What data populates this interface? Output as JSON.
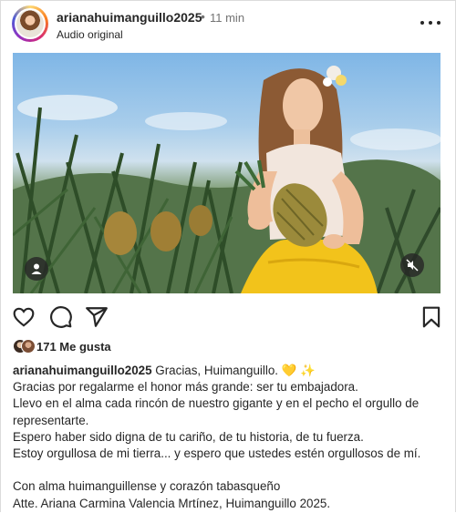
{
  "post": {
    "username": "arianahuimanguillo2025",
    "separator": "•",
    "time_ago": "11 min",
    "audio": "Audio original"
  },
  "icons": {
    "more": "more-options-icon",
    "like": "heart-icon",
    "comment": "comment-icon",
    "share": "share-icon",
    "save": "bookmark-icon",
    "tagged": "user-tag-icon",
    "mute": "muted-speaker-icon"
  },
  "likes": {
    "text": "171 Me gusta"
  },
  "caption": {
    "username": "arianahuimanguillo2025",
    "first_line": "Gracias, Huimanguillo.",
    "emoji_heart": "💛",
    "emoji_sparkle": "✨",
    "lines": [
      "Gracias por regalarme el honor más grande: ser tu embajadora.",
      "Llevo en el alma cada rincón de nuestro gigante y en el pecho el orgullo de representarte.",
      "Espero haber sido digna de tu cariño, de tu historia, de tu fuerza.",
      "Estoy orgullosa de mi tierra... y espero que ustedes estén orgullosos de mí."
    ],
    "closing": [
      "Con alma huimanguillense y corazón tabasqueño",
      "Atte. Ariana Carmina Valencia Mrtínez, Huimanguillo 2025."
    ]
  },
  "colors": {
    "text": "#262626",
    "muted": "#737373",
    "link": "#00376b",
    "dress_yellow": "#f2c31b",
    "heart_emoji": "#f5c242"
  }
}
